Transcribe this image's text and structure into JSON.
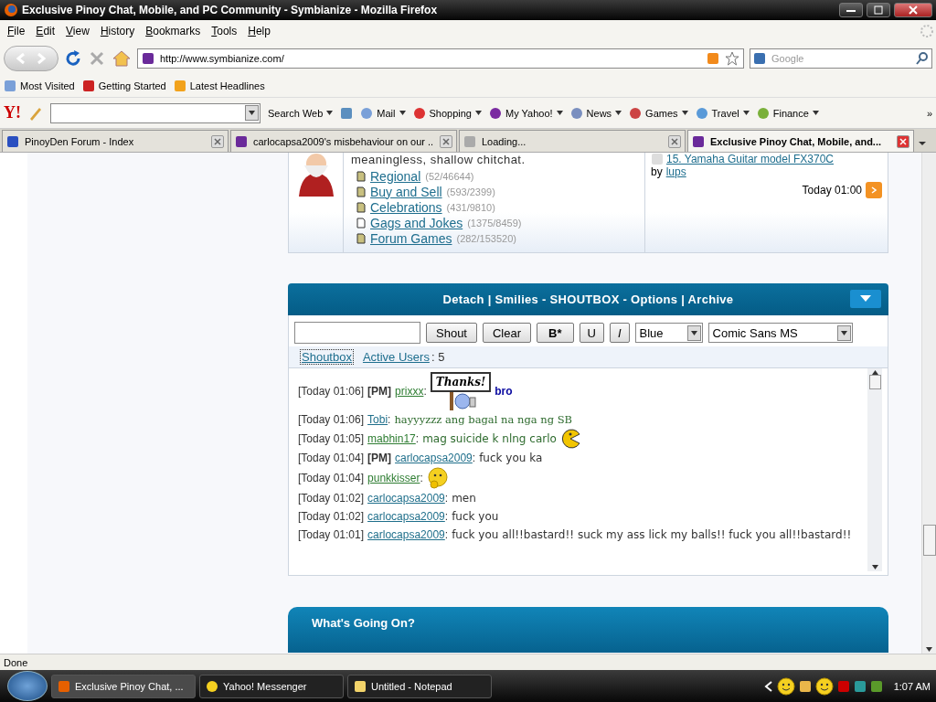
{
  "window": {
    "title": "Exclusive Pinoy Chat, Mobile, and PC Community - Symbianize - Mozilla Firefox"
  },
  "menu": [
    "File",
    "Edit",
    "View",
    "History",
    "Bookmarks",
    "Tools",
    "Help"
  ],
  "address": {
    "value": "http://www.symbianize.com/"
  },
  "search": {
    "placeholder": "Google"
  },
  "bookmarks": [
    "Most Visited",
    "Getting Started",
    "Latest Headlines"
  ],
  "yahoo_toolbar": {
    "logo": "Y!",
    "search_label": "Search Web",
    "items": [
      "Mail",
      "Shopping",
      "My Yahoo!",
      "News",
      "Games",
      "Travel",
      "Finance"
    ],
    "more": "»"
  },
  "tabs": [
    {
      "label": "PinoyDen Forum - Index",
      "selected": false
    },
    {
      "label": "carlocapsa2009's misbehaviour on our ...",
      "selected": false
    },
    {
      "label": "Loading...",
      "selected": false
    },
    {
      "label": "Exclusive Pinoy Chat, Mobile, and...",
      "selected": true
    }
  ],
  "forum": {
    "description": "meaningless, shallow chitchat.",
    "subforums": [
      {
        "name": "Regional",
        "count": "(52/46644)",
        "unread": true
      },
      {
        "name": "Buy and Sell",
        "count": "(593/2399)",
        "unread": true
      },
      {
        "name": "Celebrations",
        "count": "(431/9810)",
        "unread": true
      },
      {
        "name": "Gags and Jokes",
        "count": "(1375/8459)",
        "unread": false
      },
      {
        "name": "Forum Games",
        "count": "(282/153520)",
        "unread": true
      }
    ],
    "last_post": {
      "title": "15. Yamaha Guitar model FX370C",
      "by": "by",
      "author": "lups",
      "time": "Today 01:00"
    }
  },
  "shoutbox": {
    "header": "Detach | Smilies - SHOUTBOX - Options | Archive",
    "buttons": [
      "Shout",
      "Clear",
      "B*",
      "U",
      "I"
    ],
    "color_select": "Blue",
    "font_select": "Comic Sans MS",
    "tabs": [
      {
        "label": "Shoutbox",
        "selected": true
      },
      {
        "label": "Active Users",
        "selected": false
      }
    ],
    "active_count": ": 5",
    "messages": [
      {
        "time": "[Today 01:06]",
        "pm_label": "[PM]",
        "user": {
          "name": "prixxx",
          "color": "#2e7d32"
        },
        "separator": ":",
        "parts": [
          {
            "kind": "sign",
            "text": "Thanks!"
          },
          {
            "kind": "bold",
            "text": "bro",
            "color": "#0a0aa0"
          }
        ]
      },
      {
        "time": "[Today 01:06]",
        "user": {
          "name": "Tobi",
          "color": "#1f6f8b"
        },
        "separator": ":",
        "parts": [
          {
            "kind": "serif",
            "text": "hayyyzzz ang bagal na nga ng SB",
            "color": "#2e6b2e"
          }
        ]
      },
      {
        "time": "[Today 01:05]",
        "user": {
          "name": "mabhin17",
          "color": "#2e7d32"
        },
        "separator": ":",
        "parts": [
          {
            "kind": "comic",
            "text": "mag suicide k nlng carlo",
            "color": "#2e6b2e"
          },
          {
            "kind": "pacman"
          }
        ]
      },
      {
        "time": "[Today 01:04]",
        "pm_label": "[PM]",
        "user": {
          "name": "carlocapsa2009",
          "color": "#1f6f8b"
        },
        "separator": ":",
        "parts": [
          {
            "kind": "comic",
            "text": "fuck you ka",
            "color": "#333333"
          }
        ]
      },
      {
        "time": "[Today 01:04]",
        "user": {
          "name": "punkkisser",
          "color": "#2e7d32"
        },
        "separator": ":",
        "parts": [
          {
            "kind": "thinking"
          }
        ]
      },
      {
        "time": "[Today 01:02]",
        "user": {
          "name": "carlocapsa2009",
          "color": "#1f6f8b"
        },
        "separator": ":",
        "parts": [
          {
            "kind": "comic",
            "text": "men",
            "color": "#333333"
          }
        ]
      },
      {
        "time": "[Today 01:02]",
        "user": {
          "name": "carlocapsa2009",
          "color": "#1f6f8b"
        },
        "separator": ":",
        "parts": [
          {
            "kind": "comic",
            "text": "fuck you",
            "color": "#333333"
          }
        ]
      },
      {
        "time": "[Today 01:01]",
        "user": {
          "name": "carlocapsa2009",
          "color": "#1f6f8b"
        },
        "separator": ":",
        "parts": [
          {
            "kind": "comic",
            "text": "fuck you all!!bastard!! suck my ass lick my balls!! fuck you all!!bastard!!",
            "color": "#333333"
          }
        ]
      }
    ]
  },
  "next_section": {
    "title": "What's Going On?"
  },
  "status_bar": "Done",
  "taskbar": {
    "items": [
      {
        "label": "Exclusive Pinoy Chat, ...",
        "selected": true
      },
      {
        "label": "Yahoo! Messenger",
        "selected": false
      },
      {
        "label": "Untitled - Notepad",
        "selected": false
      }
    ],
    "clock": "1:07 AM"
  }
}
